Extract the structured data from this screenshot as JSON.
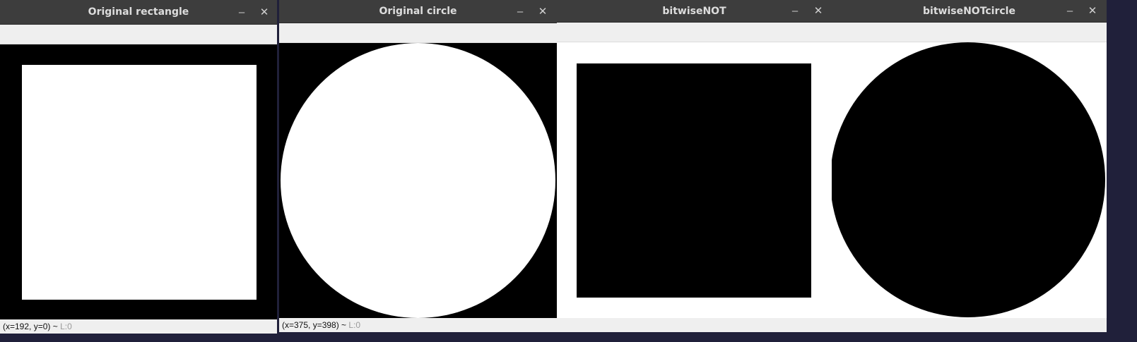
{
  "windows": [
    {
      "title": "Original rectangle",
      "status_coords": "(x=192, y=0) ~",
      "status_level": "L:0",
      "background": "#000000",
      "shape": "rectangle",
      "shape_color": "#ffffff"
    },
    {
      "title": "Original circle",
      "status_coords": "(x=375, y=398) ~",
      "status_level": "L:0",
      "background": "#000000",
      "shape": "circle",
      "shape_color": "#ffffff"
    },
    {
      "title": "bitwiseNOT",
      "status_coords": "",
      "status_level": "",
      "background": "#ffffff",
      "shape": "rectangle",
      "shape_color": "#000000"
    },
    {
      "title": "bitwiseNOTcircle",
      "status_coords": "",
      "status_level": "",
      "background": "#ffffff",
      "shape": "circle",
      "shape_color": "#000000"
    }
  ],
  "window_controls": {
    "minimize": "–",
    "close": "✕"
  }
}
